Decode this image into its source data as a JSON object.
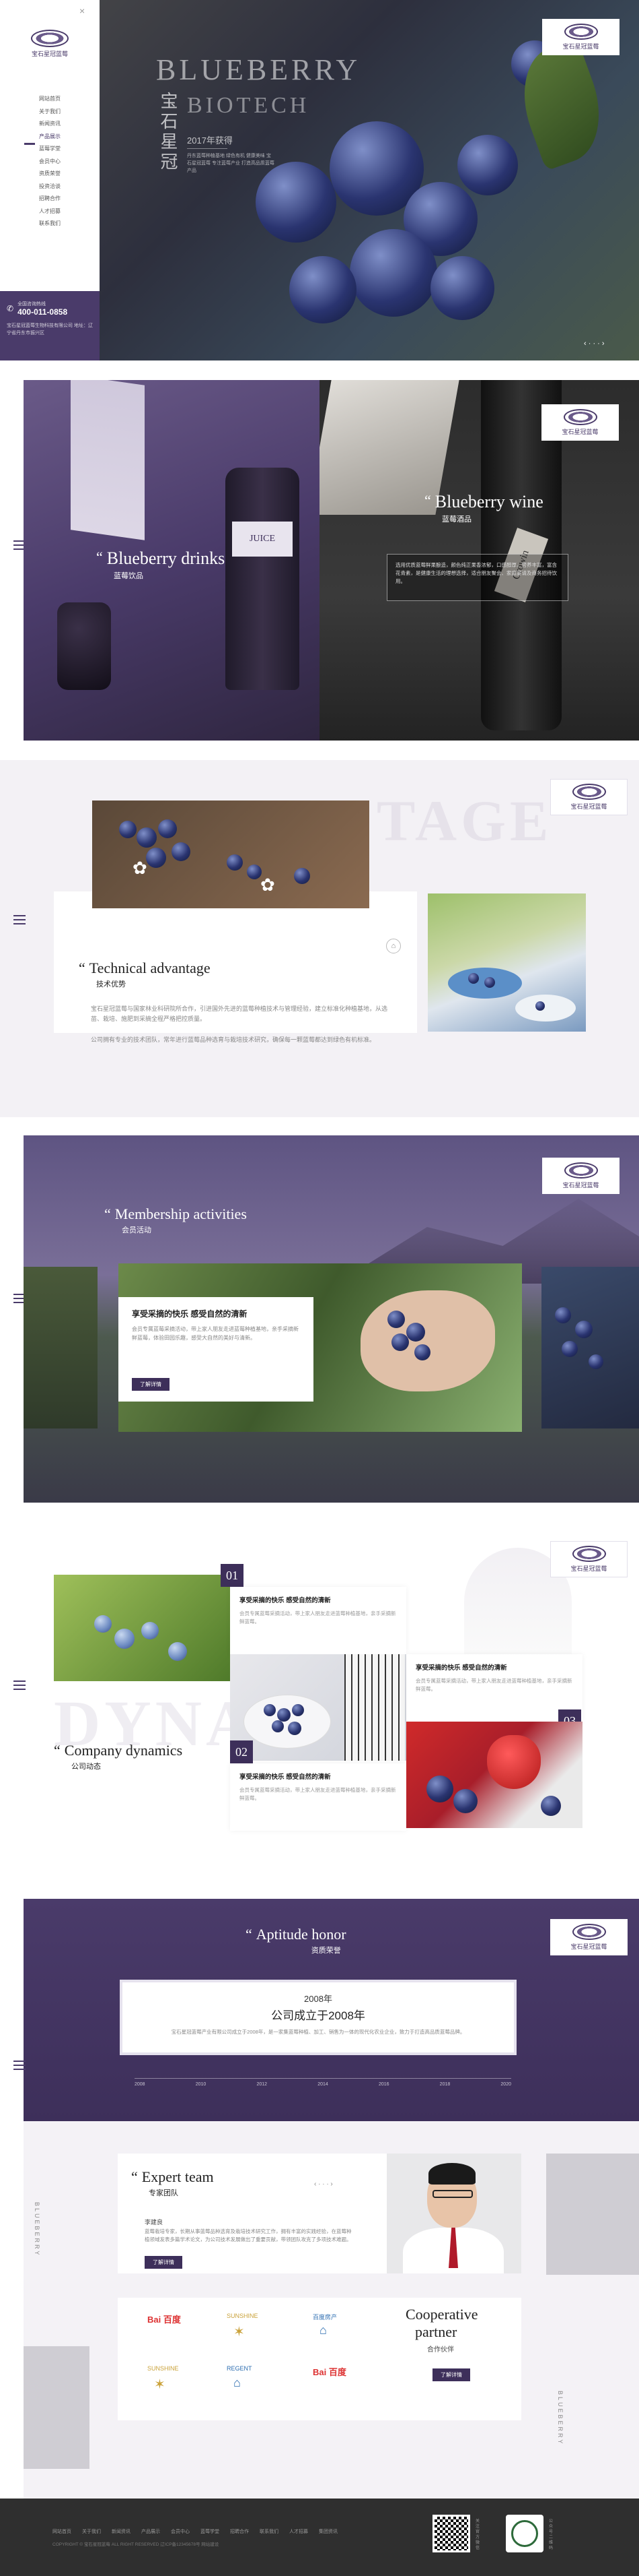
{
  "sidebar": {
    "company": "宝石星冠蓝莓",
    "menu": [
      "网站首页",
      "关于我们",
      "新闻资讯",
      "产品展示",
      "蓝莓学堂",
      "会员中心",
      "资质荣誉",
      "投资洽谈",
      "招聘合作",
      "人才招募",
      "联系我们"
    ],
    "hotline_label": "全国咨询热线",
    "hotline": "400-011-0858",
    "address": "宝石星冠蓝莓生物科技有限公司 地址：辽宁省丹东市振兴区"
  },
  "hero": {
    "line1": "BLUEBERRY",
    "line2": "BIOTECH",
    "year": "2017年获得",
    "brand_vertical": "宝石星冠",
    "desc": "丹东蓝莓种植基地 绿色有机 健康美味 宝石星冠蓝莓 专注蓝莓产业 打造高品质蓝莓产品",
    "pager": "‹  · · ·  ›"
  },
  "drinks": {
    "en": "Blueberry drinks",
    "zh": "蓝莓饮品",
    "bottle_label": "JUICE"
  },
  "wine": {
    "en": "Blueberry wine",
    "zh": "蓝莓酒品",
    "desc": "选用优质蓝莓鲜果酿造，颜色纯正果香浓郁，口感醇厚，营养丰富，富含花青素，是健康生活的理想选择，适合朋友聚会、家庭宴请及商务招待饮用。",
    "bottle_label": "Crowin"
  },
  "tech": {
    "bg_word": "TAGE",
    "en": "Technical advantage",
    "zh": "技术优势",
    "p1": "宝石星冠蓝莓与国家林业科研院所合作，引进国外先进的蓝莓种植技术与管理经验，建立标准化种植基地，从选苗、栽培、施肥到采摘全程严格把控质量。",
    "p2": "公司拥有专业的技术团队，常年进行蓝莓品种选育与栽培技术研究，确保每一颗蓝莓都达到绿色有机标准。"
  },
  "member": {
    "en": "Membership activities",
    "zh": "会员活动",
    "card_title": "享受采摘的快乐 感受自然的清新",
    "card_desc": "会员专属蓝莓采摘活动，带上家人朋友走进蓝莓种植基地，亲手采摘新鲜蓝莓，体验田园乐趣，感受大自然的美好与清新。",
    "button": "了解详情"
  },
  "news": {
    "bg_word": "DYNA",
    "en": "Company dynamics",
    "zh": "公司动态",
    "items": [
      {
        "num": "01",
        "title": "享受采摘的快乐 感受自然的清新",
        "desc": "会员专属蓝莓采摘活动，带上家人朋友走进蓝莓种植基地，亲手采摘新鲜蓝莓。"
      },
      {
        "num": "02",
        "title": "享受采摘的快乐 感受自然的清新",
        "desc": "会员专属蓝莓采摘活动，带上家人朋友走进蓝莓种植基地，亲手采摘新鲜蓝莓。"
      },
      {
        "num": "03",
        "title": "享受采摘的快乐 感受自然的清新",
        "desc": "会员专属蓝莓采摘活动，带上家人朋友走进蓝莓种植基地，亲手采摘新鲜蓝莓。"
      }
    ]
  },
  "honor": {
    "en": "Aptitude honor",
    "zh": "资质荣誉",
    "year": "2008年",
    "headline": "公司成立于2008年",
    "desc": "宝石星冠蓝莓产业有限公司成立于2008年，是一家集蓝莓种植、加工、销售为一体的现代化农业企业，致力于打造高品质蓝莓品牌。",
    "timeline": [
      "2008",
      "2010",
      "2012",
      "2014",
      "2016",
      "2018",
      "2020"
    ]
  },
  "expert": {
    "en": "Expert team",
    "zh": "专家团队",
    "name": "李建良",
    "bio": "蓝莓栽培专家，长期从事蓝莓品种选育及栽培技术研究工作，拥有丰富的实践经验，在蓝莓种植领域发表多篇学术论文，为公司技术发展做出了重要贡献，带领团队攻克了多项技术难题。",
    "button": "了解详情",
    "arrows": "‹  · · ·  ›"
  },
  "partners": {
    "en1": "Cooperative",
    "en2": "partner",
    "zh": "合作伙伴",
    "button": "了解详情",
    "logos": [
      "Bai 百度",
      "SUNSHINE",
      "百度房产",
      "SUNSHINE",
      "REGENT",
      "Bai 百度"
    ]
  },
  "footer": {
    "links": [
      "网站首页",
      "关于我们",
      "新闻资讯",
      "产品展示",
      "会员中心",
      "蓝莓学堂",
      "招聘合作",
      "联系我们",
      "人才招募",
      "集团资讯"
    ],
    "copyright": "COPYRIGHT © 宝石星冠蓝莓 ALL RIGHT RESERVED  辽ICP备12345678号  网站建设",
    "qr1": "关注官方微信",
    "qr2": "公众号二维码"
  },
  "vertical_labels": {
    "v1": "BLUEBERRY",
    "v2": "BLUEBERRY"
  },
  "colors": {
    "brand": "#4a3b6a",
    "dark": "#2f2f2f"
  }
}
